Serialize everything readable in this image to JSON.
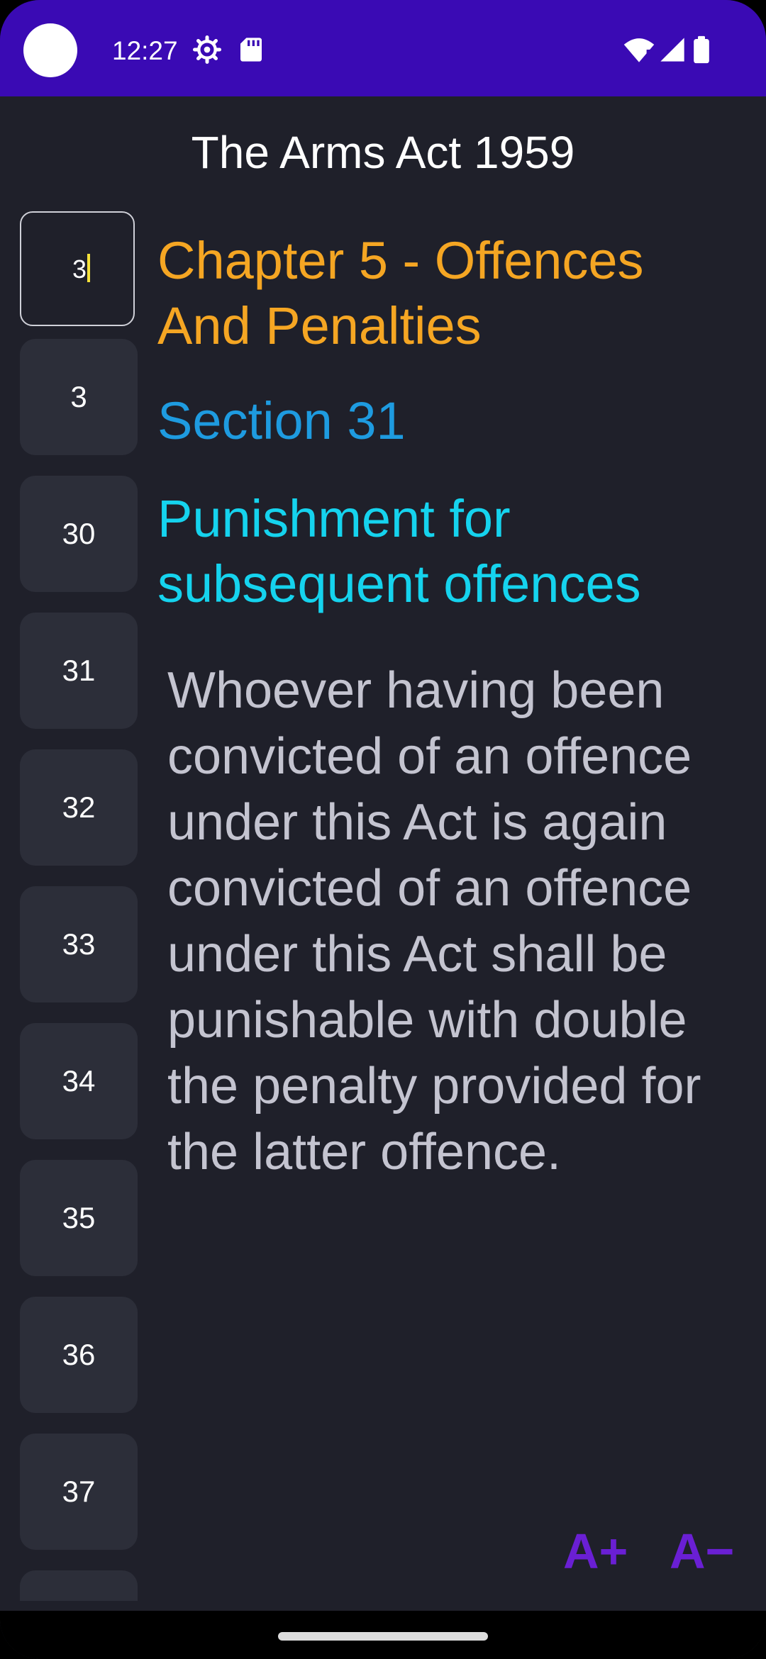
{
  "status_bar": {
    "time": "12:27",
    "color": "#3a0ab4",
    "icons": [
      "settings-icon",
      "sd-card-icon",
      "wifi-icon",
      "signal-icon",
      "battery-icon"
    ]
  },
  "app": {
    "title": "The Arms Act 1959"
  },
  "section_list": {
    "input_value": "3",
    "items": [
      "3",
      "30",
      "31",
      "32",
      "33",
      "34",
      "35",
      "36",
      "37",
      ""
    ]
  },
  "content": {
    "chapter": "Chapter 5 - Offences And Penalties",
    "section": "Section 31",
    "heading": "Punishment for subsequent offences",
    "body": "Whoever having been convicted of an offence under this Act is again convicted of an offence under this Act shall be punishable with double the penalty provided for the latter offence."
  },
  "font_controls": {
    "increase_label": "A+",
    "decrease_label": "A−"
  },
  "colors": {
    "chapter": "#f5a623",
    "section": "#1e9be0",
    "heading": "#15d3ee",
    "body": "#c4c4d0",
    "background": "#1f202a",
    "font_buttons": "#6a1fd4"
  }
}
